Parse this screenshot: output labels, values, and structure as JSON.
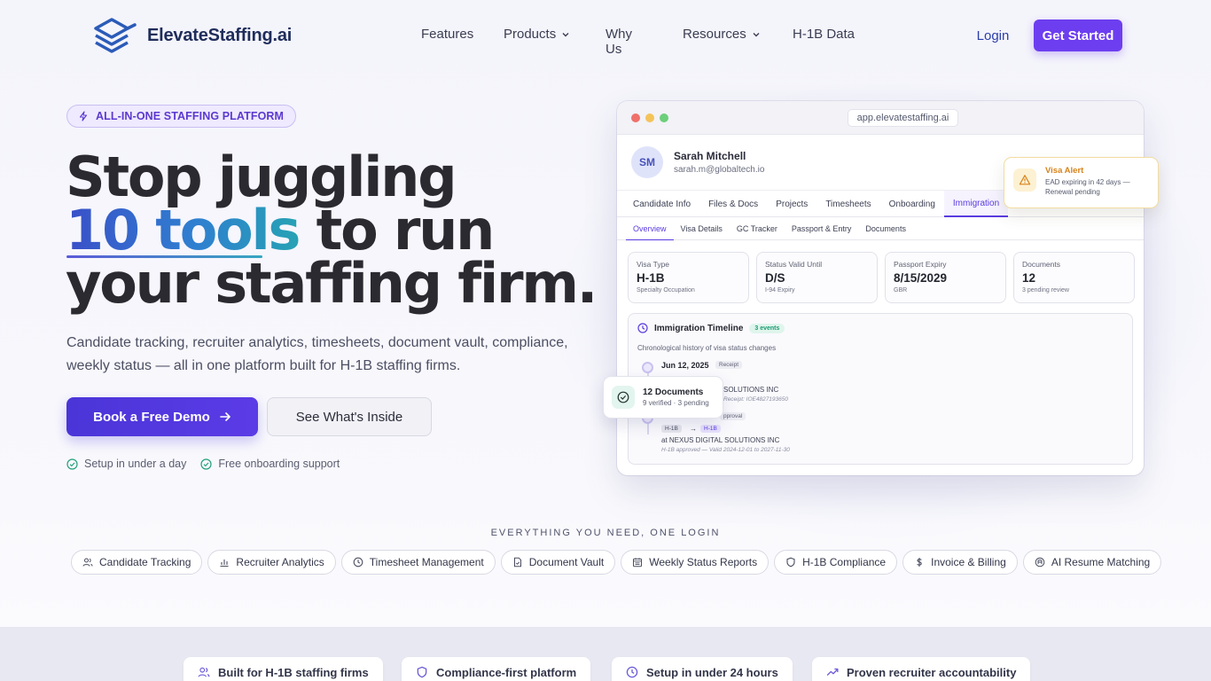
{
  "brand": {
    "name": "ElevateStaffing.ai"
  },
  "nav": {
    "links": [
      {
        "label": "Features",
        "dropdown": false
      },
      {
        "label": "Products",
        "dropdown": true
      },
      {
        "label": "Why Us",
        "dropdown": false
      },
      {
        "label": "Resources",
        "dropdown": true
      },
      {
        "label": "H-1B Data",
        "dropdown": false
      }
    ],
    "login": "Login",
    "cta": "Get Started"
  },
  "hero": {
    "pill": "ALL-IN-ONE STAFFING PLATFORM",
    "headline_1": "Stop juggling",
    "headline_accent": "10 tools",
    "headline_2": " to run",
    "headline_3": "your staffing firm.",
    "subtitle": "Candidate tracking, recruiter analytics, timesheets, document vault, compliance, weekly status — all in one platform built for H-1B staffing firms.",
    "primary_button": "Book a Free Demo",
    "secondary_button": "See What's Inside",
    "checks": [
      "Setup in under a day",
      "Free onboarding support"
    ]
  },
  "app_mock": {
    "url": "app.elevatestaffing.ai",
    "profile": {
      "initials": "SM",
      "name": "Sarah Mitchell",
      "email": "sarah.m@globaltech.io"
    },
    "tabs": [
      "Candidate Info",
      "Files & Docs",
      "Projects",
      "Timesheets",
      "Onboarding",
      "Immigration"
    ],
    "active_tab": "Immigration",
    "subtabs": [
      "Overview",
      "Visa Details",
      "GC Tracker",
      "Passport & Entry",
      "Documents"
    ],
    "active_subtab": "Overview",
    "cards": [
      {
        "label": "Visa Type",
        "value": "H-1B",
        "note": "Specialty Occupation"
      },
      {
        "label": "Status Valid Until",
        "value": "D/S",
        "note": "I-94 Expiry"
      },
      {
        "label": "Passport Expiry",
        "value": "8/15/2029",
        "note": "GBR"
      },
      {
        "label": "Documents",
        "value": "12",
        "note": "3 pending review"
      }
    ],
    "timeline": {
      "title": "Immigration Timeline",
      "badge": "3 events",
      "subtitle": "Chronological history of visa status changes",
      "event1": {
        "date": "Jun 12, 2025",
        "tag": "Receipt",
        "text": "SOLUTIONS INC",
        "meta": "Receipt: IOE4827193650"
      },
      "event2": {
        "tag": "pproval",
        "from": "H-1B",
        "to": "H-1B",
        "text": "at NEXUS DIGITAL SOLUTIONS INC",
        "meta": "H-1B approved — Valid 2024-12-01 to 2027-11-30"
      }
    }
  },
  "visa_alert": {
    "title": "Visa Alert",
    "text": "EAD expiring in 42 days — Renewal pending"
  },
  "docs_card": {
    "title": "12 Documents",
    "subtitle": "9 verified · 3 pending"
  },
  "features": {
    "heading": "EVERYTHING YOU NEED, ONE LOGIN",
    "chips": [
      {
        "label": "Candidate Tracking",
        "icon": "users-icon"
      },
      {
        "label": "Recruiter Analytics",
        "icon": "bar-chart-icon"
      },
      {
        "label": "Timesheet Management",
        "icon": "clock-icon"
      },
      {
        "label": "Document Vault",
        "icon": "document-icon"
      },
      {
        "label": "Weekly Status Reports",
        "icon": "calendar-icon"
      },
      {
        "label": "H-1B Compliance",
        "icon": "shield-icon"
      },
      {
        "label": "Invoice & Billing",
        "icon": "dollar-icon"
      },
      {
        "label": "AI Resume Matching",
        "icon": "ai-icon"
      }
    ]
  },
  "trust": [
    {
      "label": "Built for H-1B staffing firms",
      "icon": "users-icon"
    },
    {
      "label": "Compliance-first platform",
      "icon": "shield-icon"
    },
    {
      "label": "Setup in under 24 hours",
      "icon": "clock-icon"
    },
    {
      "label": "Proven recruiter accountability",
      "icon": "trend-icon"
    }
  ],
  "colors": {
    "brand_purple": "#6d3ef0",
    "accent_blue": "#3a4fc8",
    "accent_teal": "#27a2b4",
    "alert_orange": "#d7831b"
  }
}
